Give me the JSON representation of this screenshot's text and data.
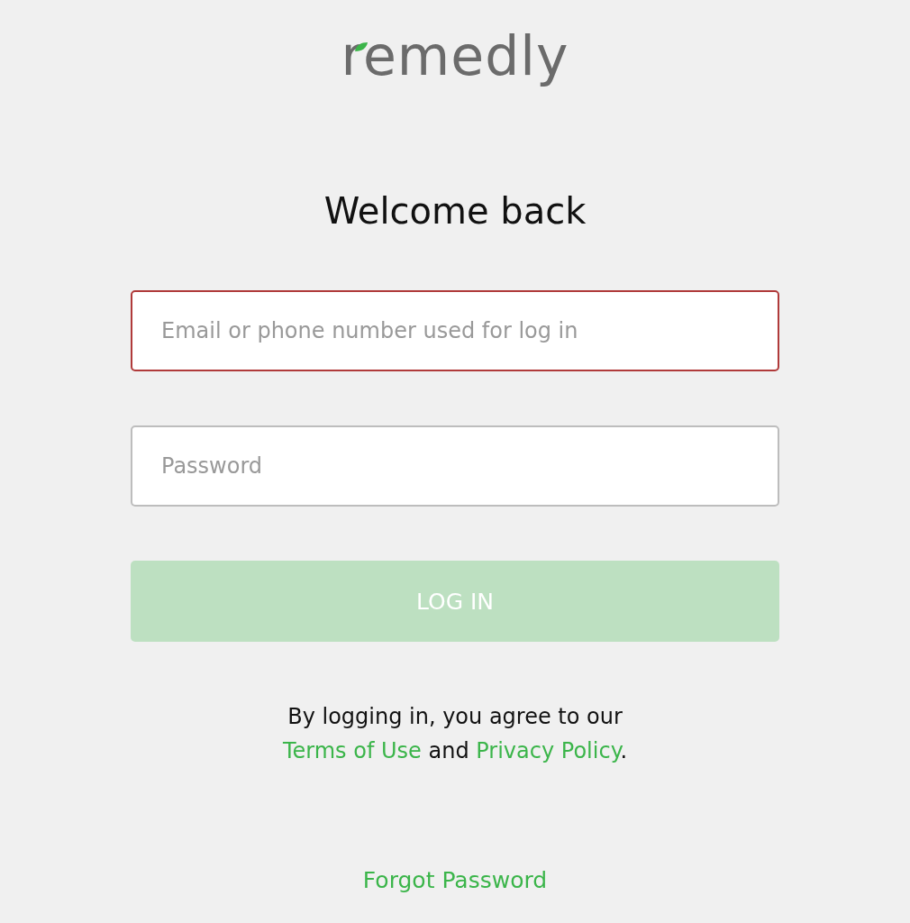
{
  "logo": {
    "text": "remedly"
  },
  "title": "Welcome back",
  "email_field": {
    "placeholder": "Email or phone number used for log in",
    "invalid": true
  },
  "password_field": {
    "placeholder": "Password",
    "invalid": false
  },
  "login_button": {
    "label": "LOG IN",
    "disabled": true
  },
  "agreement": {
    "before": "By logging in, you agree to our",
    "terms_link": "Terms of Use",
    "middle": "and",
    "privacy_link": "Privacy Policy",
    "end": "."
  },
  "forgot_link": "Forgot Password"
}
